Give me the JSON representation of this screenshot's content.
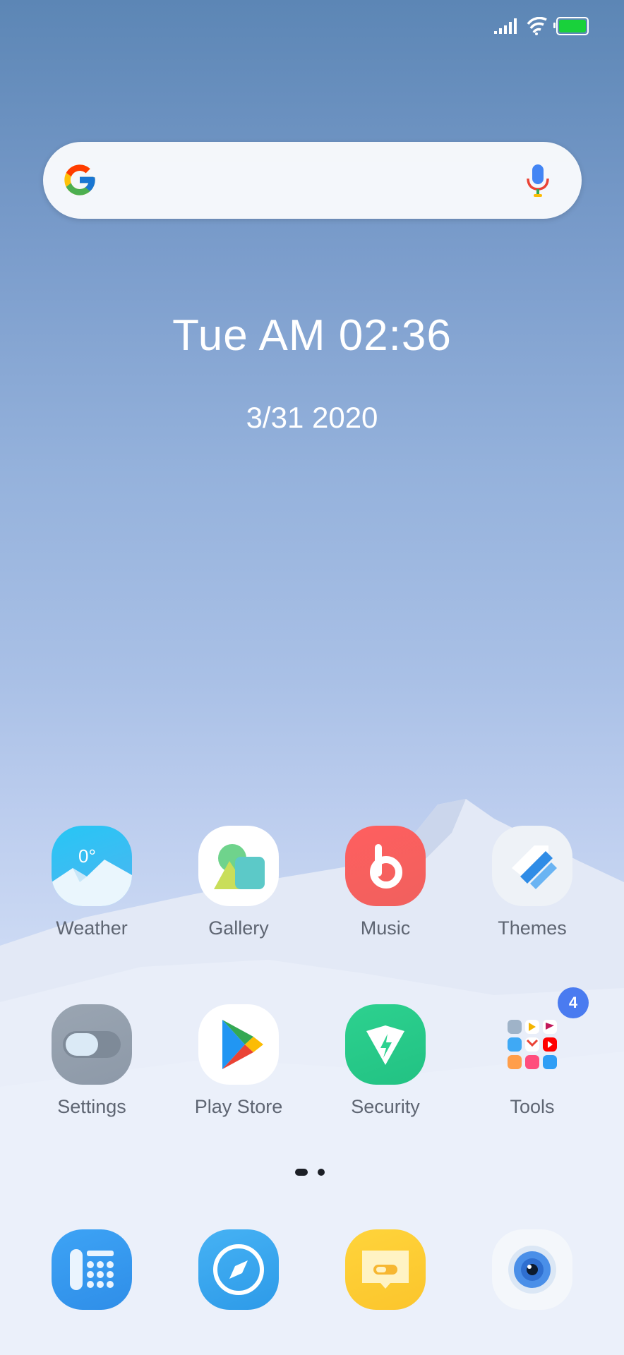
{
  "status_bar": {
    "signal_icon": "signal-bars-icon",
    "wifi_icon": "wifi-icon",
    "battery_icon": "battery-icon",
    "battery_color": "#19d13b"
  },
  "search_bar": {
    "logo_icon": "google-g-icon",
    "mic_icon": "microphone-icon"
  },
  "clock": {
    "time": "Tue AM 02:36",
    "date": "3/31 2020"
  },
  "apps": {
    "weather": {
      "label": "Weather",
      "temp": "0°"
    },
    "gallery": {
      "label": "Gallery"
    },
    "music": {
      "label": "Music"
    },
    "themes": {
      "label": "Themes"
    },
    "settings": {
      "label": "Settings"
    },
    "play_store": {
      "label": "Play Store"
    },
    "security": {
      "label": "Security"
    },
    "tools": {
      "label": "Tools",
      "badge": "4"
    }
  },
  "page_indicator": {
    "pages": 2,
    "current": 1
  },
  "dock": [
    "phone-icon",
    "browser-compass-icon",
    "messaging-icon",
    "camera-icon"
  ]
}
